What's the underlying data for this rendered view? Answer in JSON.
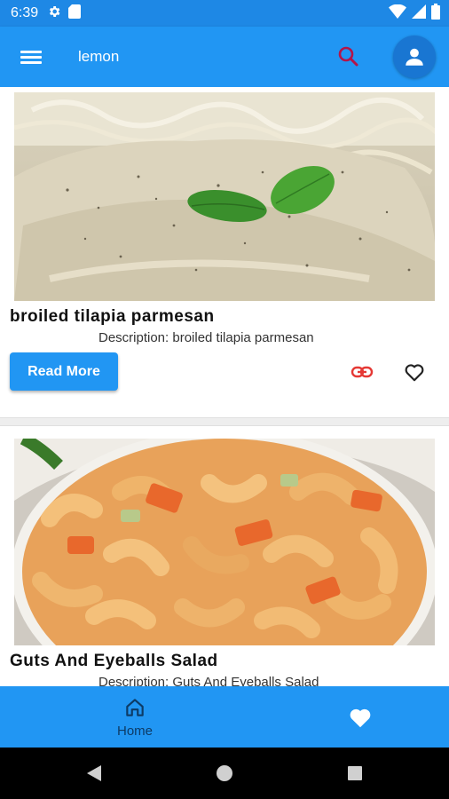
{
  "status_bar": {
    "time": "6:39",
    "left_icons": [
      "gear-icon",
      "sd-card-icon"
    ],
    "right_icons": [
      "wifi-icon",
      "signal-icon",
      "battery-icon"
    ]
  },
  "app_bar": {
    "search_value": "lemon",
    "icons": [
      "menu-icon",
      "search-icon",
      "account-icon"
    ]
  },
  "recipes": [
    {
      "title": "broiled tilapia parmesan",
      "description": "Description:  broiled tilapia parmesan",
      "read_more_label": "Read More"
    },
    {
      "title": "Guts And Eyeballs Salad",
      "description": "Description:  Guts And Eyeballs Salad"
    }
  ],
  "bottom_nav": {
    "home_label": "Home",
    "icons": [
      "home-icon",
      "heart-icon"
    ]
  },
  "colors": {
    "primary": "#2196f3",
    "status_bar": "#1e88e5",
    "link_icon": "#e53935",
    "search_icon": "#b3154a"
  }
}
